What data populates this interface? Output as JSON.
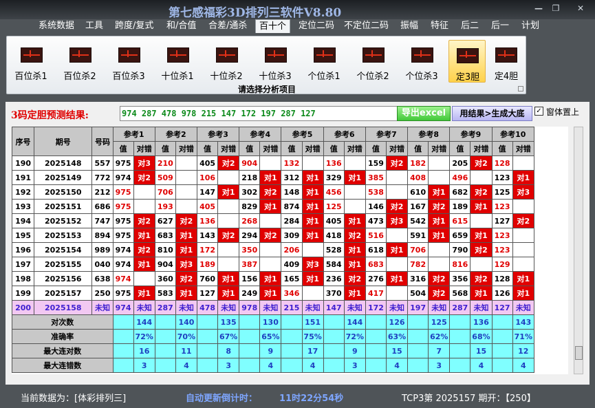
{
  "app": {
    "title": "第七感福彩3D排列三软件V8.80"
  },
  "menu": [
    "系统数据",
    "工具",
    "跨度/复式",
    "和/合值",
    "合差/通杀",
    "百十个",
    "定位二码",
    "不定位二码",
    "振幅",
    "特征",
    "后二",
    "后一",
    "计划"
  ],
  "menu_active": 5,
  "ribbon": {
    "buttons": [
      "百位杀1",
      "百位杀2",
      "百位杀3",
      "十位杀1",
      "十位杀2",
      "十位杀3",
      "个位杀1",
      "个位杀2",
      "个位杀3",
      "定3胆",
      "定4胆"
    ],
    "selected": 9,
    "caption": "请选择分析项目"
  },
  "result": {
    "label": "3码定胆预测结果:",
    "value": "974 287 478 978 215 147 172 197 287 127"
  },
  "buttons": {
    "excel": "导出excel",
    "generate": "用结果>生成大底"
  },
  "checkbox": {
    "label": "窗体置上",
    "checked": true,
    "mark": "✓"
  },
  "grid": {
    "col_headers": [
      "序号",
      "期号",
      "号码"
    ],
    "ref_labels": [
      "参考1",
      "参考2",
      "参考3",
      "参考4",
      "参考5",
      "参考6",
      "参考7",
      "参考8",
      "参考9",
      "参考10"
    ],
    "sub_labels": [
      "值",
      "对错"
    ],
    "rows": [
      {
        "seq": "190",
        "issue": "2025148",
        "num": "557",
        "cells": [
          [
            "975",
            "对3"
          ],
          [
            "210",
            ""
          ],
          [
            "405",
            "对2"
          ],
          [
            "904",
            ""
          ],
          [
            "132",
            ""
          ],
          [
            "136",
            ""
          ],
          [
            "159",
            "对2"
          ],
          [
            "182",
            ""
          ],
          [
            "205",
            "对2"
          ],
          [
            "128",
            ""
          ]
        ]
      },
      {
        "seq": "191",
        "issue": "2025149",
        "num": "772",
        "cells": [
          [
            "974",
            "对2"
          ],
          [
            "509",
            ""
          ],
          [
            "106",
            ""
          ],
          [
            "218",
            "对1"
          ],
          [
            "312",
            "对1"
          ],
          [
            "329",
            "对1"
          ],
          [
            "385",
            ""
          ],
          [
            "408",
            ""
          ],
          [
            "496",
            ""
          ],
          [
            "123",
            "对1"
          ]
        ]
      },
      {
        "seq": "192",
        "issue": "2025150",
        "num": "212",
        "cells": [
          [
            "975",
            ""
          ],
          [
            "706",
            ""
          ],
          [
            "147",
            "对1"
          ],
          [
            "302",
            "对2"
          ],
          [
            "148",
            "对1"
          ],
          [
            "456",
            ""
          ],
          [
            "538",
            ""
          ],
          [
            "610",
            "对1"
          ],
          [
            "682",
            "对2"
          ],
          [
            "125",
            "对3"
          ]
        ]
      },
      {
        "seq": "193",
        "issue": "2025151",
        "num": "686",
        "cells": [
          [
            "975",
            ""
          ],
          [
            "193",
            ""
          ],
          [
            "405",
            ""
          ],
          [
            "829",
            "对1"
          ],
          [
            "874",
            "对1"
          ],
          [
            "125",
            ""
          ],
          [
            "146",
            "对2"
          ],
          [
            "167",
            "对2"
          ],
          [
            "189",
            "对1"
          ],
          [
            "123",
            ""
          ]
        ]
      },
      {
        "seq": "194",
        "issue": "2025152",
        "num": "747",
        "cells": [
          [
            "975",
            "对2"
          ],
          [
            "627",
            "对2"
          ],
          [
            "136",
            ""
          ],
          [
            "268",
            ""
          ],
          [
            "284",
            "对1"
          ],
          [
            "405",
            "对1"
          ],
          [
            "473",
            "对3"
          ],
          [
            "542",
            "对1"
          ],
          [
            "615",
            ""
          ],
          [
            "127",
            "对2"
          ]
        ]
      },
      {
        "seq": "195",
        "issue": "2025153",
        "num": "894",
        "cells": [
          [
            "975",
            "对1"
          ],
          [
            "683",
            "对1"
          ],
          [
            "143",
            "对2"
          ],
          [
            "294",
            "对2"
          ],
          [
            "309",
            "对1"
          ],
          [
            "418",
            "对2"
          ],
          [
            "516",
            ""
          ],
          [
            "591",
            "对1"
          ],
          [
            "659",
            "对1"
          ],
          [
            "123",
            ""
          ]
        ]
      },
      {
        "seq": "196",
        "issue": "2025154",
        "num": "989",
        "cells": [
          [
            "974",
            "对2"
          ],
          [
            "810",
            "对1"
          ],
          [
            "172",
            ""
          ],
          [
            "350",
            ""
          ],
          [
            "206",
            ""
          ],
          [
            "528",
            "对1"
          ],
          [
            "618",
            "对1"
          ],
          [
            "706",
            ""
          ],
          [
            "790",
            "对2"
          ],
          [
            "123",
            ""
          ]
        ]
      },
      {
        "seq": "197",
        "issue": "2025155",
        "num": "040",
        "cells": [
          [
            "974",
            "对1"
          ],
          [
            "904",
            "对3"
          ],
          [
            "189",
            ""
          ],
          [
            "387",
            ""
          ],
          [
            "409",
            "对3"
          ],
          [
            "584",
            "对1"
          ],
          [
            "683",
            ""
          ],
          [
            "782",
            ""
          ],
          [
            "816",
            ""
          ],
          [
            "129",
            ""
          ]
        ]
      },
      {
        "seq": "198",
        "issue": "2025156",
        "num": "638",
        "cells": [
          [
            "974",
            ""
          ],
          [
            "360",
            "对2"
          ],
          [
            "760",
            "对1"
          ],
          [
            "156",
            "对1"
          ],
          [
            "165",
            "对1"
          ],
          [
            "236",
            "对2"
          ],
          [
            "276",
            "对1"
          ],
          [
            "316",
            "对2"
          ],
          [
            "356",
            "对2"
          ],
          [
            "128",
            "对1"
          ]
        ]
      },
      {
        "seq": "199",
        "issue": "2025157",
        "num": "250",
        "cells": [
          [
            "975",
            "对1"
          ],
          [
            "583",
            "对1"
          ],
          [
            "127",
            "对1"
          ],
          [
            "249",
            "对1"
          ],
          [
            "346",
            ""
          ],
          [
            "370",
            "对1"
          ],
          [
            "417",
            ""
          ],
          [
            "504",
            "对2"
          ],
          [
            "568",
            "对1"
          ],
          [
            "126",
            "对1"
          ]
        ]
      },
      {
        "seq": "200",
        "issue": "2025158",
        "num": "未知",
        "cells": [
          [
            "974",
            "未知"
          ],
          [
            "287",
            "未知"
          ],
          [
            "478",
            "未知"
          ],
          [
            "978",
            "未知"
          ],
          [
            "215",
            "未知"
          ],
          [
            "147",
            "未知"
          ],
          [
            "172",
            "未知"
          ],
          [
            "197",
            "未知"
          ],
          [
            "287",
            "未知"
          ],
          [
            "127",
            "未知"
          ]
        ]
      }
    ],
    "stats": [
      {
        "label": "对次数",
        "values": [
          "144",
          "140",
          "135",
          "130",
          "151",
          "144",
          "126",
          "125",
          "136",
          "143"
        ]
      },
      {
        "label": "准确率",
        "values": [
          "72%",
          "70%",
          "67%",
          "65%",
          "75%",
          "72%",
          "63%",
          "62%",
          "68%",
          "71%"
        ]
      },
      {
        "label": "最大连对数",
        "values": [
          "16",
          "11",
          "8",
          "9",
          "17",
          "9",
          "15",
          "7",
          "15",
          "12"
        ]
      },
      {
        "label": "最大连错数",
        "values": [
          "3",
          "4",
          "3",
          "4",
          "4",
          "3",
          "4",
          "3",
          "4",
          "4"
        ]
      }
    ]
  },
  "status": {
    "current": "当前数据为：[体彩排列三]",
    "countdown_label": "自动更新倒计时：",
    "countdown_value": "11时22分54秒",
    "issue_info": "TCP3第 2025157 期开：【250】"
  }
}
